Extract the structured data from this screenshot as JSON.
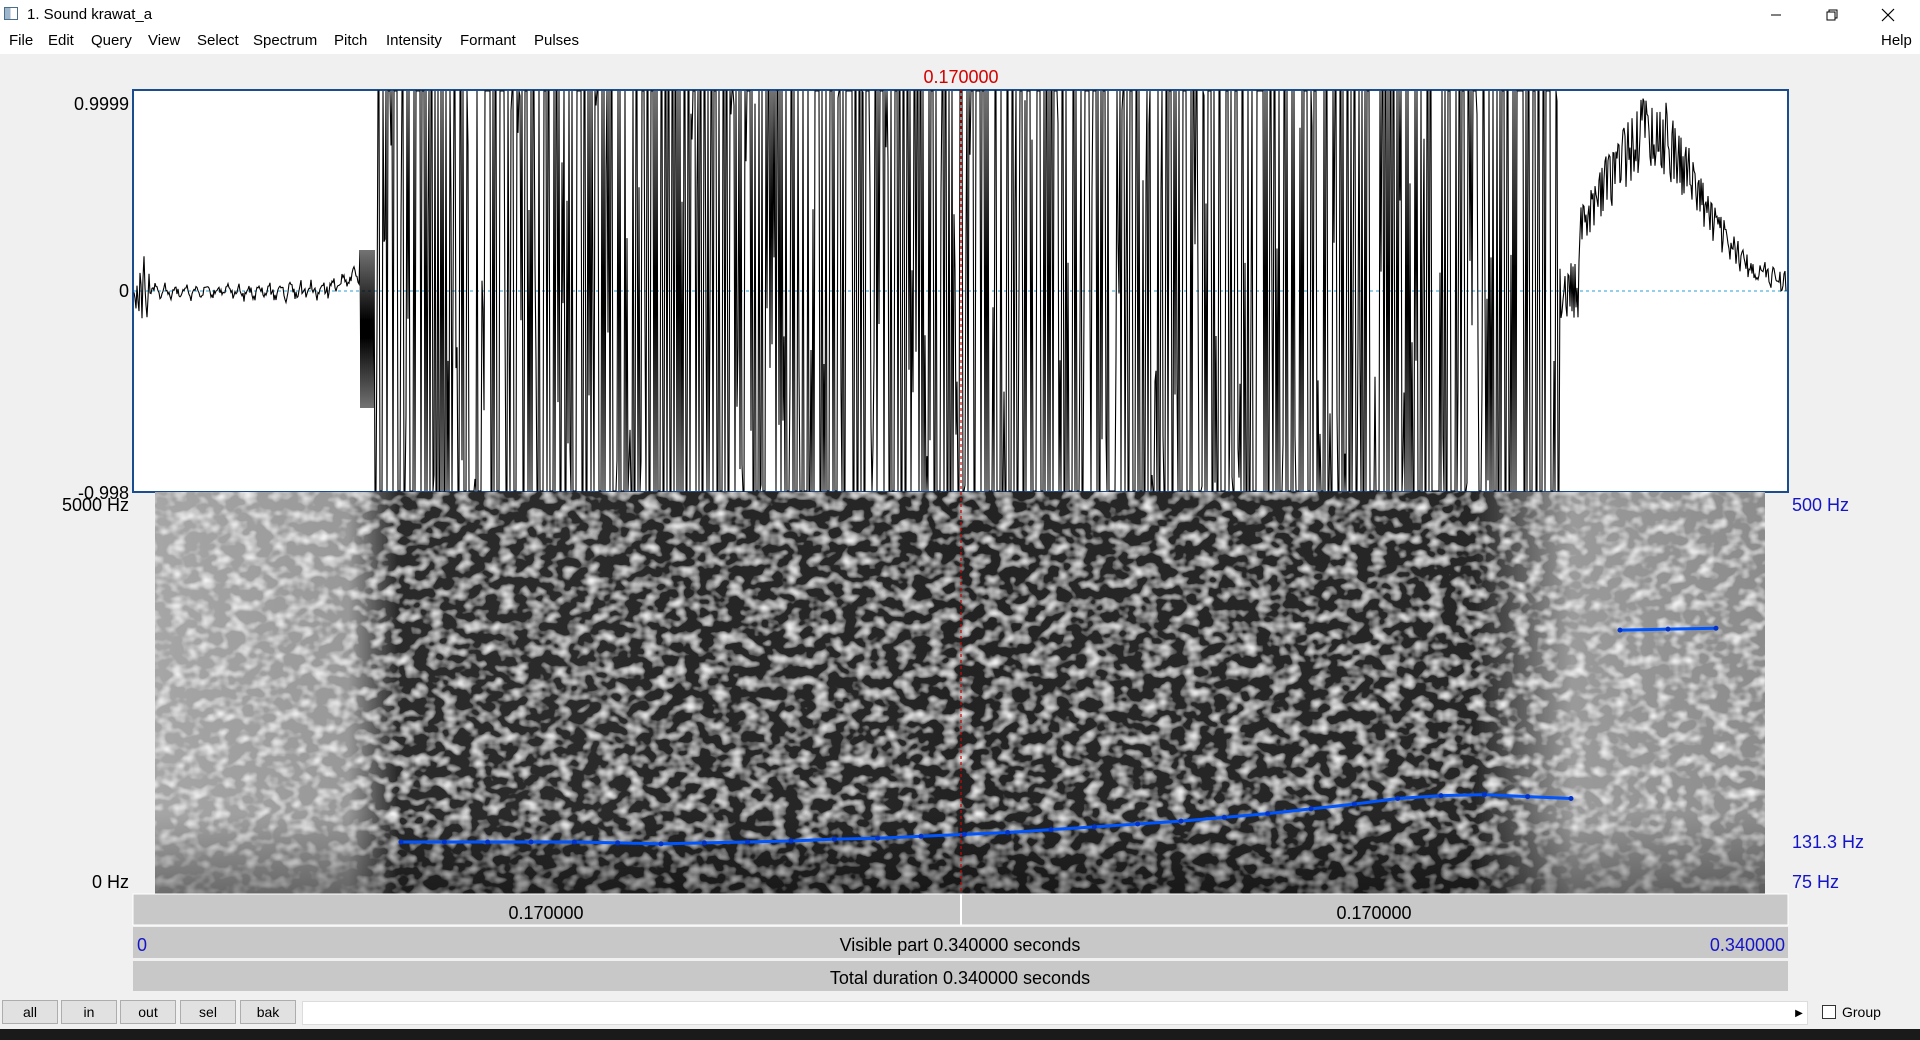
{
  "window": {
    "title": "1. Sound krawat_a"
  },
  "menu": {
    "items": [
      "File",
      "Edit",
      "Query",
      "View",
      "Select",
      "Spectrum",
      "Pitch",
      "Intensity",
      "Formant",
      "Pulses"
    ],
    "help": "Help"
  },
  "cursor_time": "0.170000",
  "waveform": {
    "ymax": "0.9999",
    "yzero": "0",
    "ymin": "-0.998"
  },
  "spectrogram": {
    "fmax": "5000 Hz",
    "fmin": "0 Hz"
  },
  "pitch": {
    "ceiling": "500 Hz",
    "cursor_value": "131.3 Hz",
    "floor": "75 Hz",
    "contour1": [
      130,
      130,
      130,
      130,
      130,
      129,
      128,
      129,
      130,
      131,
      133,
      134,
      136,
      138,
      140,
      143,
      146,
      149,
      152,
      156,
      160,
      165,
      170,
      176,
      179,
      180,
      178,
      176
    ],
    "contour2": [
      354,
      355,
      356
    ]
  },
  "segments": {
    "left": "0.170000",
    "right": "0.170000"
  },
  "visible": {
    "start": "0",
    "label": "Visible part 0.340000 seconds",
    "end": "0.340000"
  },
  "total": {
    "label": "Total duration 0.340000 seconds"
  },
  "buttons": {
    "all": "all",
    "in": "in",
    "out": "out",
    "sel": "sel",
    "bak": "bak"
  },
  "group": {
    "label": "Group"
  },
  "colors": {
    "cursor": "#d40000",
    "pitch": "#0055ff",
    "pitch_text": "#1515c8",
    "dotted": "#2a9fd6"
  }
}
